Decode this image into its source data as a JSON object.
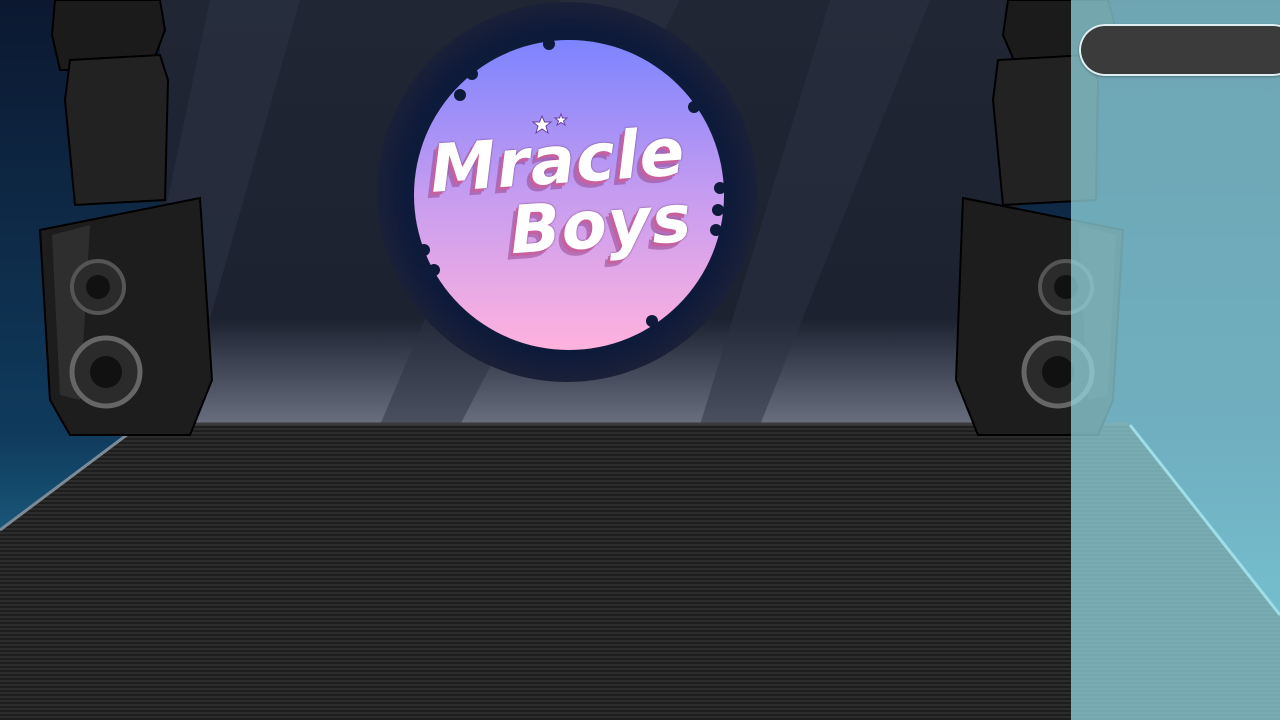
{
  "logo": {
    "line1": "Mracle",
    "line2": "Boys"
  },
  "top_menu_button": {
    "label": ""
  },
  "colors": {
    "stage_back": "#1f2533",
    "floor": "#2a2a2a",
    "logo_top": "#7f86ff",
    "logo_bottom": "#ffb0e0",
    "side_panel": "#96dce6",
    "button": "#3b3b3b"
  },
  "icons": {
    "left_speaker": "speaker-stack-icon",
    "right_speaker": "speaker-stack-icon",
    "stars": "star-icon"
  }
}
